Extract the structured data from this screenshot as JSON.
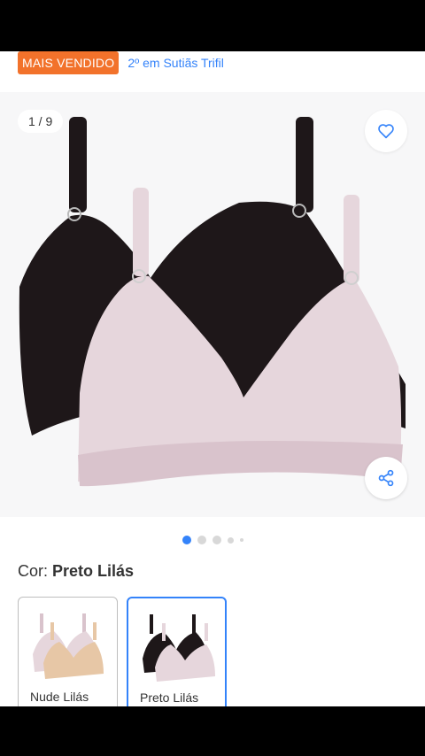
{
  "header": {
    "badge": "MAIS VENDIDO",
    "rank_text": "2º em Sutiãs Trifil"
  },
  "gallery": {
    "counter": "1 / 9",
    "active_index": 0,
    "dots_total": 5
  },
  "color_selector": {
    "label": "Cor:",
    "value": "Preto Lilás",
    "options": [
      {
        "label": "Nude Lilás",
        "selected": false
      },
      {
        "label": "Preto Lilás",
        "selected": true
      }
    ]
  },
  "colors": {
    "accent": "#3483fa",
    "badge": "#f2722b",
    "black_garment": "#1e1719",
    "lilac_garment": "#e6d6dc",
    "nude_garment": "#e7c7a6"
  },
  "icons": {
    "favorite": "heart-icon",
    "share": "share-icon"
  }
}
